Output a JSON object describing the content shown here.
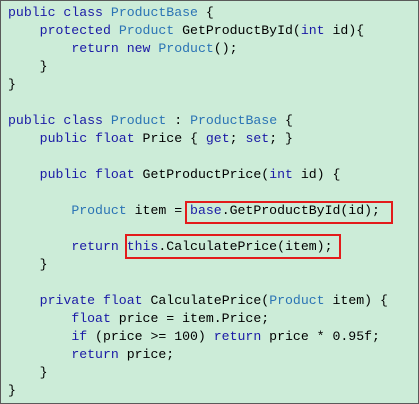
{
  "colors": {
    "background": "#ccecd8",
    "keyword": "#1a1aa6",
    "type": "#2b74b5",
    "text": "#000000",
    "highlight_box": "#e31b1b"
  },
  "code_lines": [
    [
      {
        "t": "public",
        "c": "kw"
      },
      {
        "t": " "
      },
      {
        "t": "class",
        "c": "kw"
      },
      {
        "t": " "
      },
      {
        "t": "ProductBase",
        "c": "ty"
      },
      {
        "t": " {"
      }
    ],
    [
      {
        "t": "    "
      },
      {
        "t": "protected",
        "c": "kw"
      },
      {
        "t": " "
      },
      {
        "t": "Product",
        "c": "ty"
      },
      {
        "t": " GetProductById("
      },
      {
        "t": "int",
        "c": "kw"
      },
      {
        "t": " id){"
      }
    ],
    [
      {
        "t": "        "
      },
      {
        "t": "return",
        "c": "kw"
      },
      {
        "t": " "
      },
      {
        "t": "new",
        "c": "kw"
      },
      {
        "t": " "
      },
      {
        "t": "Product",
        "c": "ty"
      },
      {
        "t": "();"
      }
    ],
    [
      {
        "t": "    }"
      }
    ],
    [
      {
        "t": "}"
      }
    ],
    [],
    [
      {
        "t": "public",
        "c": "kw"
      },
      {
        "t": " "
      },
      {
        "t": "class",
        "c": "kw"
      },
      {
        "t": " "
      },
      {
        "t": "Product",
        "c": "ty"
      },
      {
        "t": " : "
      },
      {
        "t": "ProductBase",
        "c": "ty"
      },
      {
        "t": " {"
      }
    ],
    [
      {
        "t": "    "
      },
      {
        "t": "public",
        "c": "kw"
      },
      {
        "t": " "
      },
      {
        "t": "float",
        "c": "kw"
      },
      {
        "t": " Price { "
      },
      {
        "t": "get",
        "c": "kw"
      },
      {
        "t": "; "
      },
      {
        "t": "set",
        "c": "kw"
      },
      {
        "t": "; }"
      }
    ],
    [],
    [
      {
        "t": "    "
      },
      {
        "t": "public",
        "c": "kw"
      },
      {
        "t": " "
      },
      {
        "t": "float",
        "c": "kw"
      },
      {
        "t": " GetProductPrice("
      },
      {
        "t": "int",
        "c": "kw"
      },
      {
        "t": " id) {"
      }
    ],
    [],
    [
      {
        "t": "        "
      },
      {
        "t": "Product",
        "c": "ty"
      },
      {
        "t": " item = "
      },
      {
        "t": "base",
        "c": "kw"
      },
      {
        "t": ".GetProductById(id);"
      }
    ],
    [],
    [
      {
        "t": "        "
      },
      {
        "t": "return",
        "c": "kw"
      },
      {
        "t": " "
      },
      {
        "t": "this",
        "c": "kw"
      },
      {
        "t": ".CalculatePrice(item);"
      }
    ],
    [
      {
        "t": "    }"
      }
    ],
    [],
    [
      {
        "t": "    "
      },
      {
        "t": "private",
        "c": "kw"
      },
      {
        "t": " "
      },
      {
        "t": "float",
        "c": "kw"
      },
      {
        "t": " CalculatePrice("
      },
      {
        "t": "Product",
        "c": "ty"
      },
      {
        "t": " item) {"
      }
    ],
    [
      {
        "t": "        "
      },
      {
        "t": "float",
        "c": "kw"
      },
      {
        "t": " price = item.Price;"
      }
    ],
    [
      {
        "t": "        "
      },
      {
        "t": "if",
        "c": "kw"
      },
      {
        "t": " (price >= 100) "
      },
      {
        "t": "return",
        "c": "kw"
      },
      {
        "t": " price * 0.95f;"
      }
    ],
    [
      {
        "t": "        "
      },
      {
        "t": "return",
        "c": "kw"
      },
      {
        "t": " price;"
      }
    ],
    [
      {
        "t": "    }"
      }
    ],
    [
      {
        "t": "}"
      }
    ]
  ]
}
